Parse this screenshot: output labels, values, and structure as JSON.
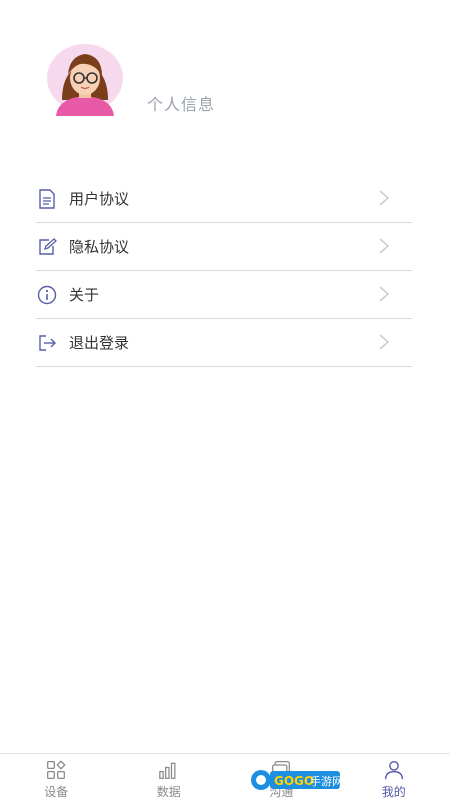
{
  "profile": {
    "name": "个人信息"
  },
  "menu": [
    {
      "label": "用户协议",
      "icon": "document-icon"
    },
    {
      "label": "隐私协议",
      "icon": "edit-icon"
    },
    {
      "label": "关于",
      "icon": "info-icon"
    },
    {
      "label": "退出登录",
      "icon": "logout-icon"
    }
  ],
  "tabbar": [
    {
      "label": "设备",
      "icon": "grid-icon",
      "active": false
    },
    {
      "label": "数据",
      "icon": "bar-chart-icon",
      "active": false
    },
    {
      "label": "沟通",
      "icon": "chat-icon",
      "active": false
    },
    {
      "label": "我的",
      "icon": "person-icon",
      "active": true
    }
  ],
  "watermark": {
    "text": "GOGO手游网"
  },
  "colors": {
    "accent": "#5056a6",
    "icon": "#5a5fa8",
    "muted": "#8a8a8a",
    "divider": "#d9d9d9"
  }
}
